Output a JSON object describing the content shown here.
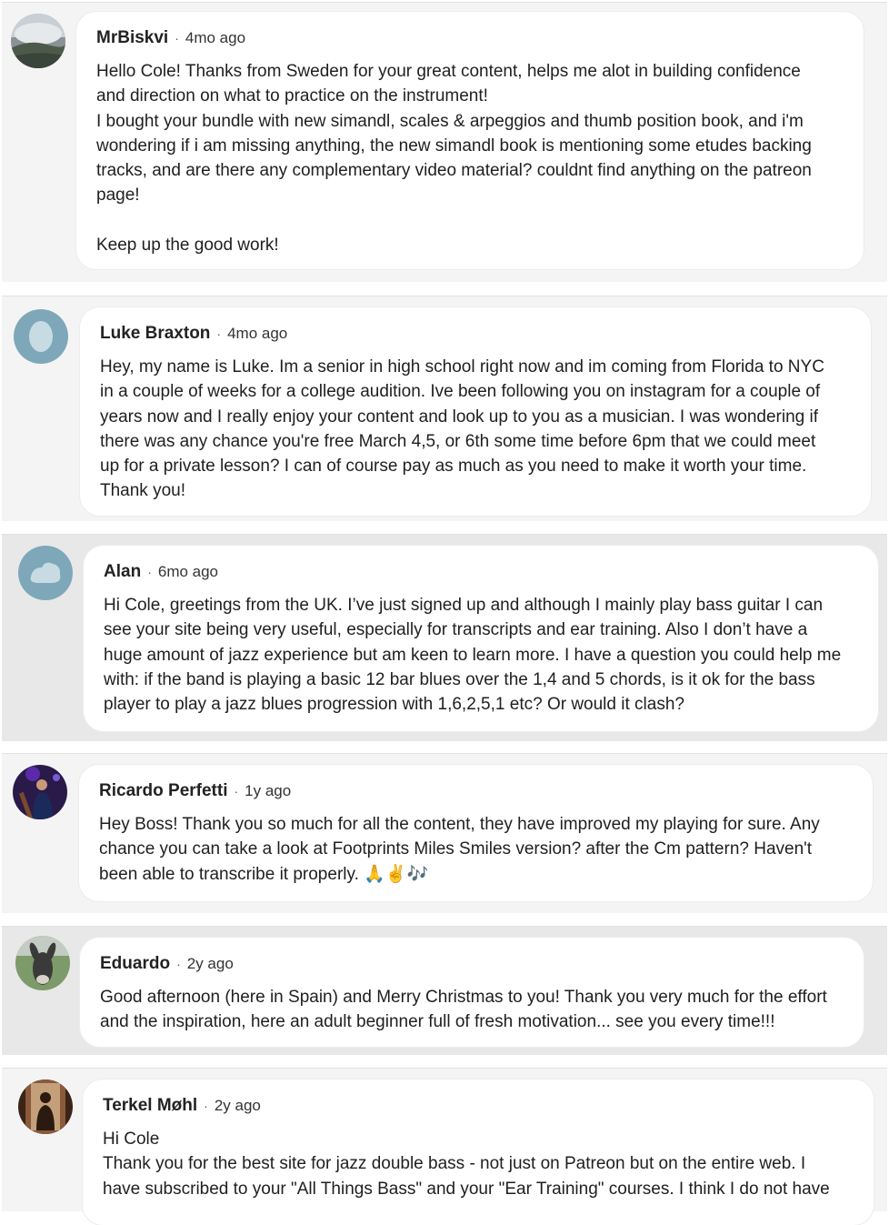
{
  "comments": [
    {
      "author": "MrBiskvi",
      "time": "4mo ago",
      "avatar": "landscape-avatar",
      "text": "Hello Cole! Thanks from Sweden for your great content, helps me alot in building confidence\nand direction on what to practice on the instrument!\nI bought your bundle with new simandl, scales & arpeggios and thumb position book, and i'm\nwondering if i am missing anything, the new simandl book is mentioning some etudes backing\ntracks, and are there any complementary video material? couldnt find anything on the patreon\npage!\n\nKeep up the good work!"
    },
    {
      "author": "Luke Braxton",
      "time": "4mo ago",
      "avatar": "default-avatar",
      "text": "Hey, my name is Luke. Im a senior in high school right now and im coming from Florida to NYC\nin a couple of weeks for a college audition. Ive been following you on instagram for a couple of\nyears now and I really enjoy your content and look up to you as a musician. I was wondering if\nthere was any chance you're free March 4,5, or 6th some time before 6pm that we could meet\nup for a private lesson? I can of course pay as much as you need to make it worth your time.\nThank you!"
    },
    {
      "author": "Alan",
      "time": "6mo ago",
      "avatar": "default-avatar",
      "text": "Hi Cole, greetings from the UK. I’ve just signed up and although I mainly play bass guitar I can\nsee your site being very useful, especially for transcripts and ear training. Also I don’t have a\nhuge amount of jazz experience but am keen to learn more. I have a question you could help me\nwith: if the band is playing a basic 12 bar blues over the 1,4 and 5 chords, is it ok for the bass\nplayer to play a jazz blues progression with 1,6,2,5,1 etc? Or would it clash?"
    },
    {
      "author": "Ricardo Perfetti",
      "time": "1y ago",
      "avatar": "musician-avatar",
      "text": "Hey Boss! Thank you so much for all the content, they have improved my playing for sure. Any\nchance you can take a look at Footprints Miles Smiles version? after the Cm pattern? Haven't\nbeen able to transcribe it properly. 🙏✌️🎶"
    },
    {
      "author": "Eduardo",
      "time": "2y ago",
      "avatar": "donkey-avatar",
      "text": "Good afternoon (here in Spain) and Merry Christmas to you! Thank you very much for the effort\nand the inspiration, here an adult beginner full of fresh motivation... see you every time!!!"
    },
    {
      "author": "Terkel Møhl",
      "time": "2y ago",
      "avatar": "portrait-avatar",
      "text": "Hi Cole\nThank you for the best site for jazz double bass - not just on Patreon but on the entire web. I\nhave subscribed to your \"All Things Bass\" and your \"Ear Training\" courses. I think I do not have"
    }
  ],
  "separator": "·",
  "colors": {
    "page_background": "#f4f4f4",
    "bubble_background": "#ffffff",
    "default_avatar": "#7ea8ba"
  }
}
